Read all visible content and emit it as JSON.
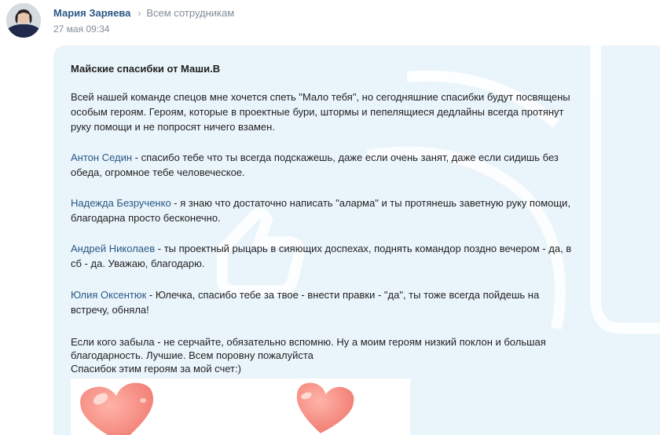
{
  "post": {
    "author": "Мария Заряева",
    "recipient": "Всем сотрудникам",
    "timestamp": "27 мая 09:34",
    "title": "Майские спасибки от Маши.В",
    "intro": "Всей нашей команде спецов мне хочется спеть \"Мало тебя\", но сегодняшние спасибки будут посвящены особым героям. Героям, которые в проектные бури, штормы и пепелящиеся дедлайны всегда протянут руку помощи и не попросят ничего взамен.",
    "thanks": [
      {
        "name": "Антон Седин",
        "text": " - спасибо тебе что ты всегда подскажешь, даже если очень занят, даже если сидишь без обеда, огромное тебе человеческое."
      },
      {
        "name": "Надежда Безрученко",
        "text": "  - я знаю что достаточно написать \"аларма\" и ты протянешь заветную руку помощи, благодарна просто бесконечно."
      },
      {
        "name": "Андрей Николаев",
        "text": " - ты проектный рыцарь в сияющих доспехах, поднять командор поздно вечером - да, в сб - да. Уважаю, благодарю."
      },
      {
        "name": "Юлия Оксентюк",
        "text": "  - Юлечка, спасибо тебе за твое - внести правки - \"да\", ты тоже всегда пойдешь на встречу, обняла!"
      }
    ],
    "outro_1": "Если кого забыла - не серчайте, обязательно вспомню. Ну а моим героям низкий поклон и большая благодарность. Лучшие. Всем поровну пожалуйста",
    "outro_2": "Спасибок этим героям за мой счет:)"
  },
  "colors": {
    "link": "#2a5885",
    "card_bg": "#eaf5fb",
    "heart": "#f2877f"
  },
  "icons": {
    "separator": "chevron-right-icon",
    "attachment": "hearts-image"
  }
}
